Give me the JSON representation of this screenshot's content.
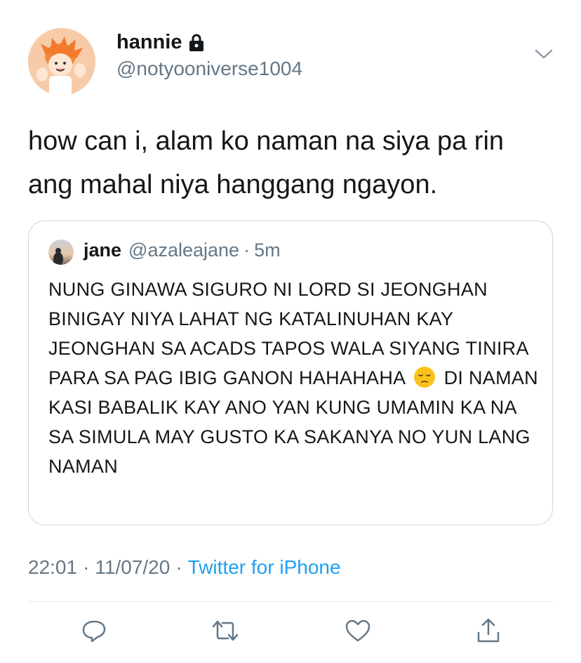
{
  "tweet": {
    "display_name": "hannie",
    "handle": "@notyooniverse1004",
    "text": "how can i, alam ko naman na siya pa rin ang mahal niya hanggang ngayon.",
    "time": "22:01",
    "date": "11/07/20",
    "source": "Twitter for iPhone",
    "separator": "·"
  },
  "quote": {
    "name": "jane",
    "handle": "@azaleajane",
    "separator": "·",
    "age": "5m",
    "text_before_emoji": "NUNG GINAWA SIGURO NI LORD SI JEONGHAN BINIGAY NIYA LAHAT NG KATALINUHAN KAY JEONGHAN SA ACADS TAPOS WALA SIYANG TINIRA PARA SA PAG IBIG GANON HAHAHAHA",
    "text_after_emoji": "DI NAMAN KASI BABALIK KAY ANO YAN KUNG UMAMIN KA NA SA SIMULA MAY GUSTO KA SAKANYA NO YUN LANG NAMAN",
    "emoji": "pensive-face"
  },
  "icons": {
    "lock": "lock-icon",
    "caret": "chevron-down-icon",
    "reply": "reply-icon",
    "retweet": "retweet-icon",
    "like": "heart-icon",
    "share": "share-icon"
  },
  "colors": {
    "text": "#14171a",
    "secondary": "#657786",
    "link": "#1da1f2",
    "border": "#ccd6dd"
  }
}
